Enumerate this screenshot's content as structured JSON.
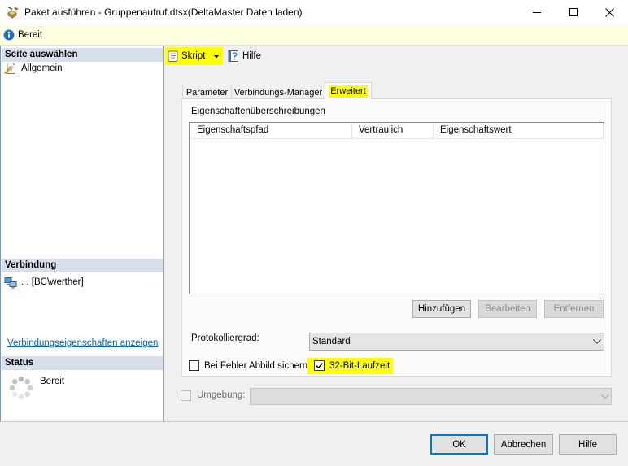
{
  "window": {
    "title": "Paket ausführen - Gruppenaufruf.dtsx(DeltaMaster Daten laden)",
    "icon": "package-execute-icon",
    "controls": [
      "minimize-icon",
      "maximize-icon",
      "close-icon"
    ]
  },
  "infobar": {
    "icon": "info-icon",
    "text": "Bereit"
  },
  "sidebar": {
    "select_page": {
      "header": "Seite auswählen",
      "items": [
        {
          "label": "Allgemein",
          "icon": "general-page-icon"
        }
      ]
    },
    "connection": {
      "header": "Verbindung",
      "icon": "server-connection-icon",
      "value": ". . [BC\\werther]",
      "link": "Verbindungseigenschaften anzeigen"
    },
    "status": {
      "header": "Status",
      "icon": "progress-spinner-icon",
      "text": "Bereit"
    }
  },
  "toolbar": {
    "script": {
      "label": "Skript",
      "icon": "script-icon",
      "has_dropdown": true
    },
    "help": {
      "label": "Hilfe",
      "icon": "help-book-icon"
    }
  },
  "tabs": [
    {
      "label": "Parameter",
      "selected": false
    },
    {
      "label": "Verbindungs-Manager",
      "selected": false
    },
    {
      "label": "Erweitert",
      "selected": true
    }
  ],
  "advanced": {
    "overrides": {
      "label": "Eigenschaftenüberschreibungen",
      "columns": [
        "Eigenschaftspfad",
        "Vertraulich",
        "Eigenschaftswert"
      ],
      "rows": []
    },
    "buttons": {
      "add": {
        "label": "Hinzufügen",
        "enabled": true
      },
      "edit": {
        "label": "Bearbeiten",
        "enabled": false
      },
      "remove": {
        "label": "Entfernen",
        "enabled": false
      }
    },
    "log_level": {
      "label": "Protokolliergrad:",
      "value": "Standard"
    },
    "dump_on_error": {
      "label": "Bei Fehler Abbild sichern",
      "checked": false
    },
    "run_32bit": {
      "label": "32-Bit-Laufzeit",
      "checked": true
    }
  },
  "environment": {
    "label": "Umgebung:",
    "checked": false,
    "enabled": false
  },
  "footer": {
    "ok": "OK",
    "cancel": "Abbrechen",
    "help": "Hilfe"
  },
  "colors": {
    "highlight": "#FFFF00",
    "infobar_background": "#FFFFE1",
    "link": "#0066CC",
    "default_button_border": "#0078D7",
    "section_header_background": "#D7DFEA"
  }
}
